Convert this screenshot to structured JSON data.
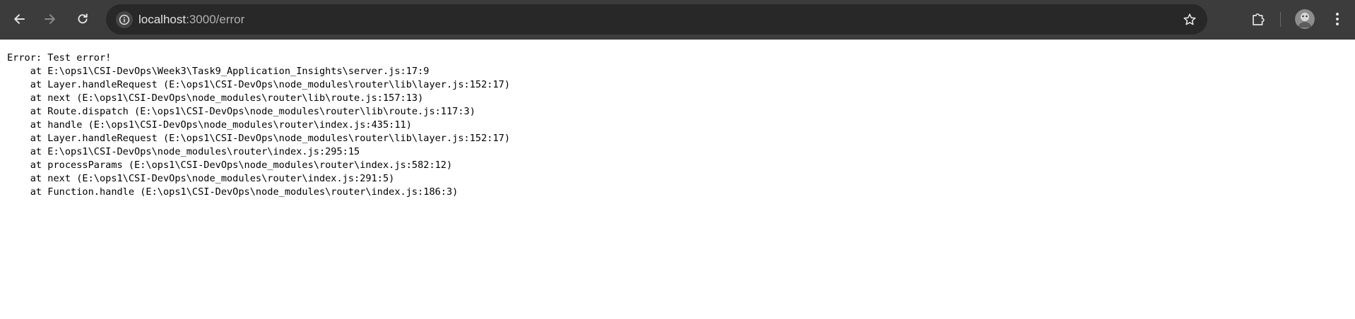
{
  "browser": {
    "url_host": "localhost",
    "url_path": ":3000/error",
    "icons": {
      "back": "arrow-left-icon",
      "forward": "arrow-right-icon",
      "reload": "reload-icon",
      "site_info": "info-icon",
      "bookmark": "star-icon",
      "extensions": "puzzle-icon",
      "profile": "avatar",
      "menu": "kebab-menu-icon"
    },
    "colors": {
      "toolbar": "#3c3c3c",
      "omnibox": "#282828",
      "url_text": "#e3e3e3"
    }
  },
  "page": {
    "error_lines": [
      "Error: Test error!",
      "    at E:\\ops1\\CSI-DevOps\\Week3\\Task9_Application_Insights\\server.js:17:9",
      "    at Layer.handleRequest (E:\\ops1\\CSI-DevOps\\node_modules\\router\\lib\\layer.js:152:17)",
      "    at next (E:\\ops1\\CSI-DevOps\\node_modules\\router\\lib\\route.js:157:13)",
      "    at Route.dispatch (E:\\ops1\\CSI-DevOps\\node_modules\\router\\lib\\route.js:117:3)",
      "    at handle (E:\\ops1\\CSI-DevOps\\node_modules\\router\\index.js:435:11)",
      "    at Layer.handleRequest (E:\\ops1\\CSI-DevOps\\node_modules\\router\\lib\\layer.js:152:17)",
      "    at E:\\ops1\\CSI-DevOps\\node_modules\\router\\index.js:295:15",
      "    at processParams (E:\\ops1\\CSI-DevOps\\node_modules\\router\\index.js:582:12)",
      "    at next (E:\\ops1\\CSI-DevOps\\node_modules\\router\\index.js:291:5)",
      "    at Function.handle (E:\\ops1\\CSI-DevOps\\node_modules\\router\\index.js:186:3)"
    ]
  }
}
